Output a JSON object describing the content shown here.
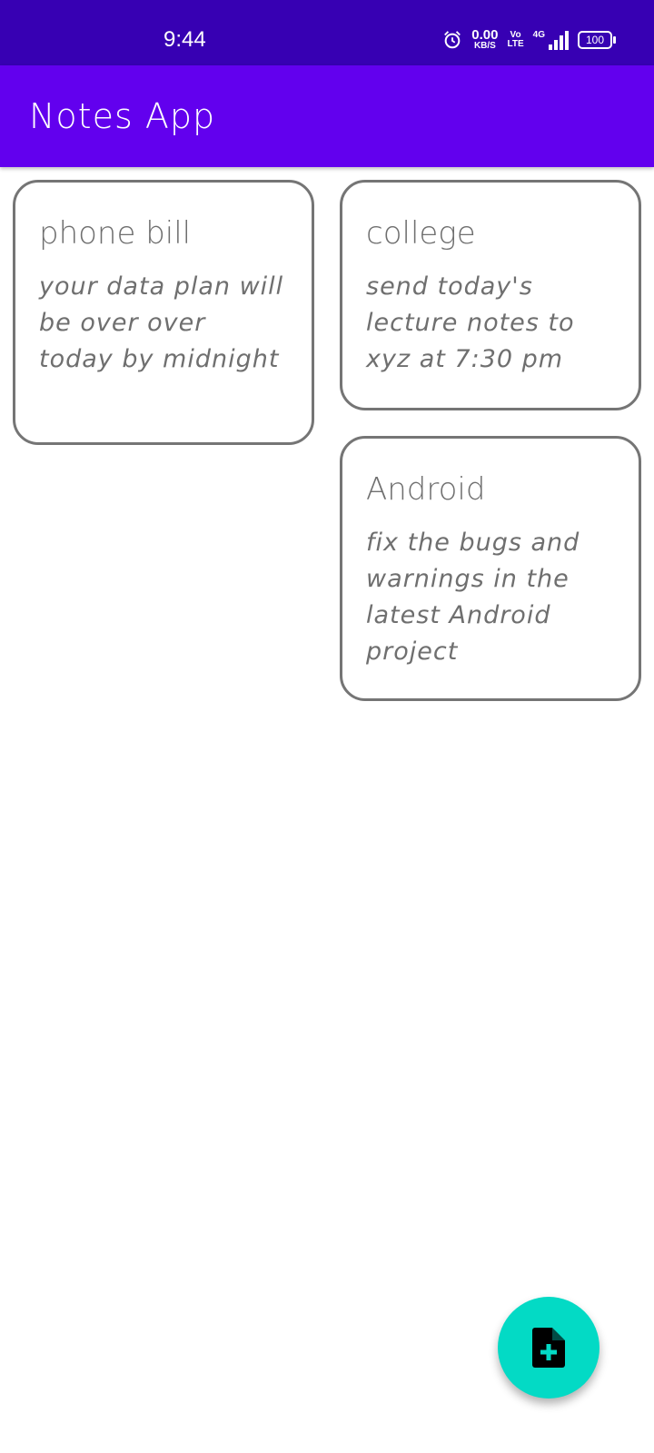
{
  "status_bar": {
    "time": "9:44",
    "net_speed_value": "0.00",
    "net_speed_unit": "KB/S",
    "volte_top": "Vo",
    "volte_bottom": "LTE",
    "network_type": "4G",
    "battery_level": "100",
    "icons": [
      "alarm-icon",
      "signal-icon",
      "battery-icon"
    ]
  },
  "app_bar": {
    "title": "Notes App",
    "color": "#6200ee"
  },
  "notes": [
    {
      "title": "phone bill",
      "body": "your data plan will be over over today by midnight"
    },
    {
      "title": "college",
      "body": "send today's lecture notes to xyz at 7:30 pm"
    },
    {
      "title": "Android",
      "body": "fix the bugs and warnings in the latest Android project"
    }
  ],
  "fab": {
    "icon": "note-add-icon",
    "color": "#03dac5"
  },
  "colors": {
    "status_bar": "#3700b3",
    "card_border": "#757575",
    "card_text": "#6f6f6f"
  }
}
